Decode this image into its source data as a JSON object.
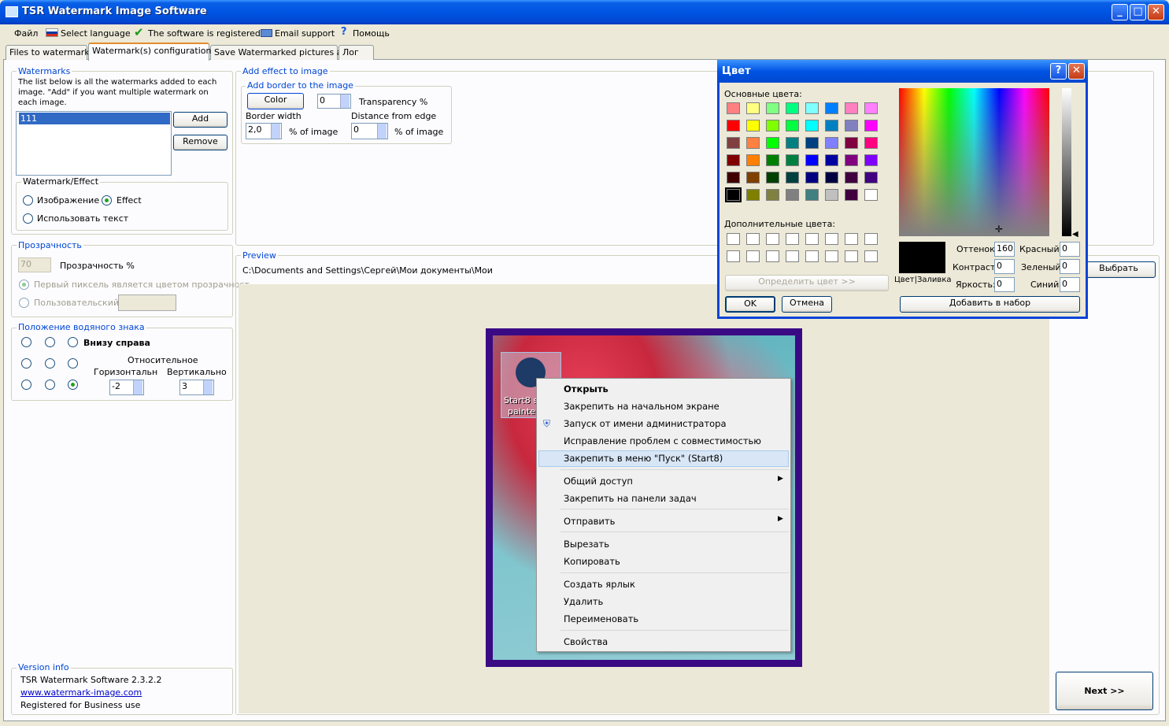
{
  "window": {
    "title": "TSR Watermark Image Software",
    "min": "_",
    "max": "□",
    "close": "✕"
  },
  "menu": [
    "Файл",
    "Select language",
    "The software is registered",
    "Email support",
    "Помощь"
  ],
  "tabs": [
    "Files to watermark",
    "Watermark(s) configuration",
    "Save Watermarked pictures as",
    "Лог"
  ],
  "watermarks": {
    "title": "Watermarks",
    "desc": "The list below is all the watermarks added to each image. \"Add\" if you want multiple watermark on each image.",
    "list": [
      "111"
    ],
    "add": "Add",
    "remove": "Remove"
  },
  "wmeffect": {
    "title": "Watermark/Effect",
    "opt_image": "Изображение",
    "opt_effect": "Effect",
    "opt_text": "Использовать текст"
  },
  "transp": {
    "title": "Прозрачность",
    "value": "70",
    "label": "Прозрачность %",
    "first_pixel": "Первый пиксель является цветом прозрачност",
    "custom": "Пользовательский ц"
  },
  "position": {
    "title": "Положение водяного знака",
    "selected": "Внизу справа",
    "relative": "Относительное",
    "horiz": "Горизонтальн",
    "vert": "Вертикально",
    "h_value": "-2",
    "v_value": "3"
  },
  "version": {
    "title": "Version info",
    "ver": "TSR Watermark Software 2.3.2.2",
    "url": "www.watermark-image.com",
    "reg": "Registered for Business use"
  },
  "effect": {
    "title": "Add effect to image",
    "border_title": "Add border to the image",
    "color_btn": "Color",
    "transparency_val": "0",
    "transparency": "Transparency %",
    "border_width": "Border width",
    "border_val": "2,0",
    "pct1": "% of image",
    "distance": "Distance from edge",
    "distance_val": "0",
    "pct2": "% of image"
  },
  "preview": {
    "title": "Preview",
    "path": "C:\\Documents and Settings\\Сергей\\Мои документы\\Мои",
    "choose": "Выбрать",
    "next": "Next >>",
    "icon_label1": "Start8 s",
    "icon_label2": "painte"
  },
  "colors": {
    "border": "#3a0a84",
    "accent": "#0046d5"
  },
  "dialog": {
    "title": "Цвет",
    "help": "?",
    "close": "✕",
    "basic": "Основные цвета:",
    "custom": "Дополнительные цвета:",
    "define": "Определить цвет >>",
    "ok": "OK",
    "cancel": "Отмена",
    "add": "Добавить в набор",
    "solid": "Цвет|Заливка",
    "hue": "Оттенок:",
    "hue_v": "160",
    "sat": "Контраст:",
    "sat_v": "0",
    "lum": "Яркость:",
    "lum_v": "0",
    "red": "Красный:",
    "red_v": "0",
    "green": "Зеленый:",
    "green_v": "0",
    "blue": "Синий:",
    "blue_v": "0",
    "swatches": [
      "#ff8080",
      "#ffff80",
      "#80ff80",
      "#00ff80",
      "#80ffff",
      "#0080ff",
      "#ff80c0",
      "#ff80ff",
      "#ff0000",
      "#ffff00",
      "#80ff00",
      "#00ff40",
      "#00ffff",
      "#0080c0",
      "#8080c0",
      "#ff00ff",
      "#804040",
      "#ff8040",
      "#00ff00",
      "#008080",
      "#004080",
      "#8080ff",
      "#800040",
      "#ff0080",
      "#800000",
      "#ff8000",
      "#008000",
      "#008040",
      "#0000ff",
      "#0000a0",
      "#800080",
      "#8000ff",
      "#400000",
      "#804000",
      "#004000",
      "#004040",
      "#000080",
      "#000040",
      "#400040",
      "#400080",
      "#000000",
      "#808000",
      "#808040",
      "#808080",
      "#408080",
      "#c0c0c0",
      "#400040",
      "#ffffff"
    ]
  },
  "context": {
    "open": "Открыть",
    "pin_start": "Закрепить на начальном экране",
    "run_admin": "Запуск от имени администратора",
    "compat": "Исправление проблем с совместимостью",
    "pin_start8": "Закрепить в меню \"Пуск\" (Start8)",
    "share": "Общий доступ",
    "pin_task": "Закрепить на панели задач",
    "send": "Отправить",
    "cut": "Вырезать",
    "copy": "Копировать",
    "shortcut": "Создать ярлык",
    "delete": "Удалить",
    "rename": "Переименовать",
    "props": "Свойства"
  }
}
